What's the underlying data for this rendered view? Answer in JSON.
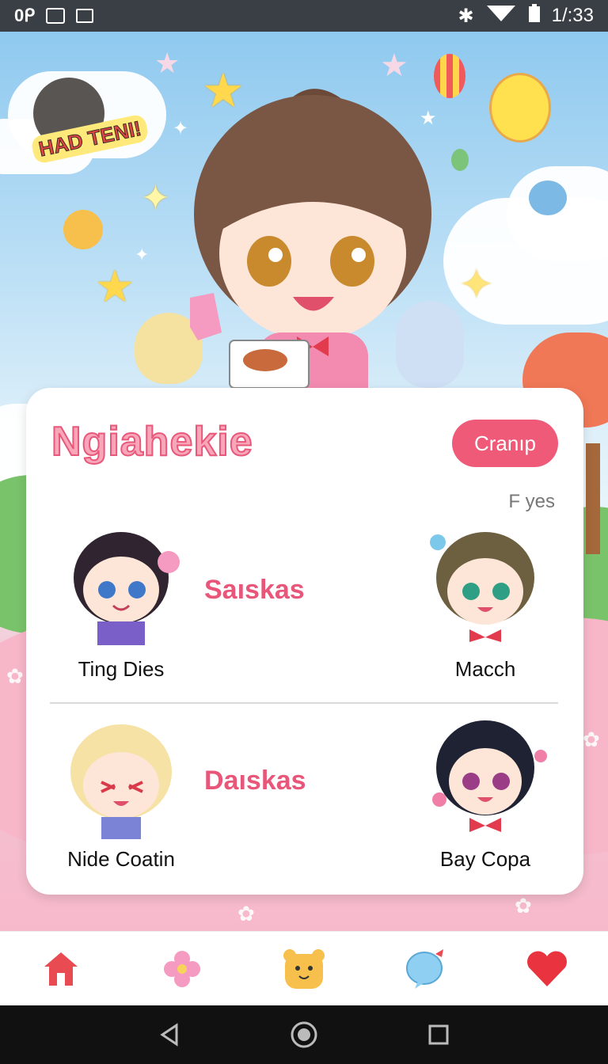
{
  "status_bar": {
    "left_text": "0ᑭ",
    "time": "1/:33",
    "icons": [
      "bluetooth-icon",
      "wifi-icon",
      "signal-icon",
      "battery-icon"
    ]
  },
  "hero": {
    "sticker_text": "HAD TENI!"
  },
  "card": {
    "title": "Ngiahekie",
    "cta_label": "Cranıp",
    "sub_label": "F yes",
    "rows": [
      {
        "left_name": "Ting Dies",
        "tag": "Saıskas",
        "right_name": "Macch"
      },
      {
        "left_name": "Nide Coatin",
        "tag": "Daıskas",
        "right_name": "Bay Copa"
      }
    ]
  },
  "bottom_nav": {
    "items": [
      "home-icon",
      "flower-icon",
      "bear-icon",
      "chat-bubble-icon",
      "heart-icon"
    ]
  },
  "colors": {
    "accent": "#ee5a78",
    "title_fill": "#f7a7b9",
    "status_bar": "#3a3f45",
    "system_nav": "#111111"
  }
}
